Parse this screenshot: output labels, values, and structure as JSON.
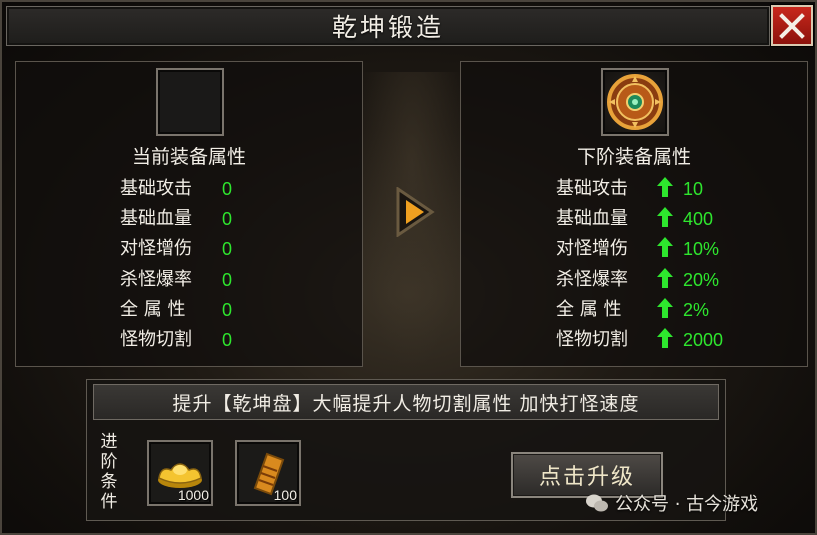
{
  "window": {
    "title": "乾坤锻造",
    "close_label": "X"
  },
  "current": {
    "heading": "当前装备属性",
    "attributes": [
      {
        "label": "基础攻击",
        "value": "0"
      },
      {
        "label": "基础血量",
        "value": "0"
      },
      {
        "label": "对怪增伤",
        "value": "0"
      },
      {
        "label": "杀怪爆率",
        "value": "0"
      },
      {
        "label": "全 属 性",
        "value": "0"
      },
      {
        "label": "怪物切割",
        "value": "0"
      }
    ]
  },
  "next": {
    "heading": "下阶装备属性",
    "attributes": [
      {
        "label": "基础攻击",
        "value": "10"
      },
      {
        "label": "基础血量",
        "value": "400"
      },
      {
        "label": "对怪增伤",
        "value": "10%"
      },
      {
        "label": "杀怪爆率",
        "value": "20%"
      },
      {
        "label": "全 属 性",
        "value": "2%"
      },
      {
        "label": "怪物切割",
        "value": "2000"
      }
    ]
  },
  "conditions": {
    "banner": "提升【乾坤盘】大幅提升人物切割属性 加快打怪速度",
    "label": "进阶条件",
    "items": [
      {
        "icon": "gold-ingot-icon",
        "count": "1000"
      },
      {
        "icon": "scroll-icon",
        "count": "100"
      }
    ],
    "button": "点击升级"
  },
  "watermark": {
    "text": "公众号 · 古今游戏"
  },
  "colors": {
    "value_green": "#2ee62e",
    "close_red": "#c8281c",
    "arrow_orange": "#f0a020"
  }
}
